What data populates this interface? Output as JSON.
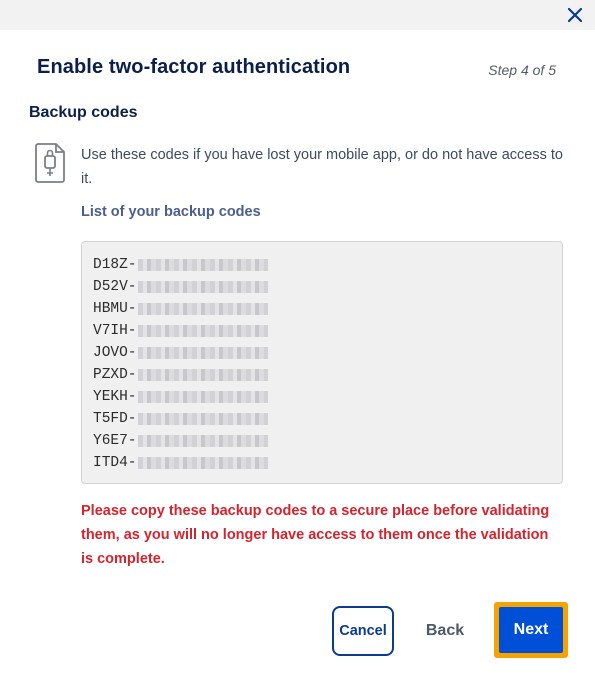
{
  "dialog": {
    "title": "Enable two-factor authentication",
    "step": "Step 4 of 5",
    "close_icon": "close-icon"
  },
  "backup": {
    "heading": "Backup codes",
    "icon": "lock-file-icon",
    "intro": "Use these codes if you have lost your mobile app, or do not have access to it.",
    "list_label": "List of your backup codes",
    "codes": [
      "D18Z-",
      "D52V-",
      "HBMU-",
      "V7IH-",
      "JOVO-",
      "PZXD-",
      "YEKH-",
      "T5FD-",
      "Y6E7-",
      "ITD4-"
    ],
    "warning_lines": [
      "Please copy these backup codes to a secure place before validating",
      "them, as you will no longer have access to them once the validation",
      "is complete."
    ]
  },
  "actions": {
    "cancel": "Cancel",
    "back": "Back",
    "next": "Next"
  },
  "colors": {
    "title": "#0b1f4a",
    "accent": "#0050d7",
    "focus": "#f5a300",
    "warning": "#d6232d"
  }
}
